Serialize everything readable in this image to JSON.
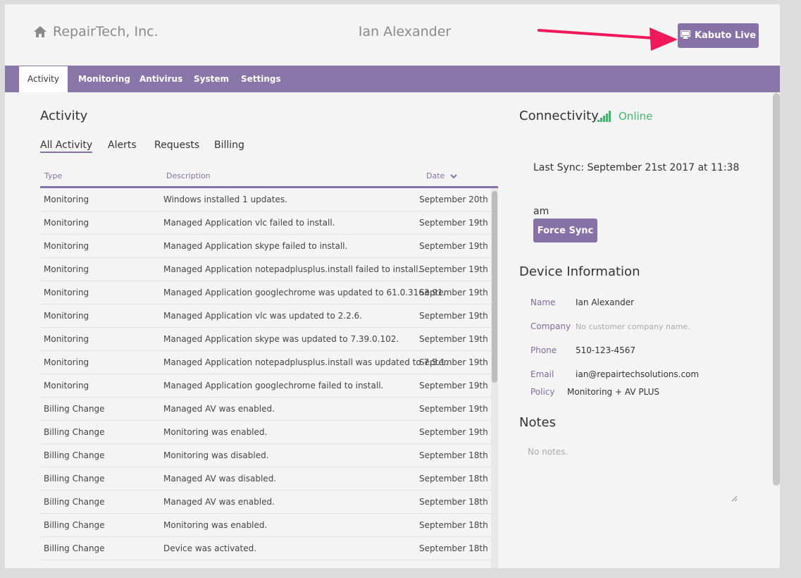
{
  "header": {
    "company": "RepairTech, Inc.",
    "user": "Ian Alexander",
    "kabuto_button": "Kabuto Live",
    "home_icon": "home-icon",
    "monitor_icon": "monitor-icon"
  },
  "tabs": [
    "Activity",
    "Monitoring",
    "Antivirus",
    "System",
    "Settings"
  ],
  "activity": {
    "title": "Activity",
    "subtabs": [
      "All Activity",
      "Alerts",
      "Requests",
      "Billing"
    ],
    "columns": {
      "type": "Type",
      "description": "Description",
      "date": "Date"
    },
    "rows": [
      {
        "type": "Monitoring",
        "description": "Windows installed 1 updates.",
        "date": "September 20th"
      },
      {
        "type": "Monitoring",
        "description": "Managed Application vlc failed to install.",
        "date": "September 19th"
      },
      {
        "type": "Monitoring",
        "description": "Managed Application skype failed to install.",
        "date": "September 19th"
      },
      {
        "type": "Monitoring",
        "description": "Managed Application notepadplusplus.install failed to install.",
        "date": "September 19th"
      },
      {
        "type": "Monitoring",
        "description": "Managed Application googlechrome was updated to 61.0.3163.91.",
        "date": "September 19th"
      },
      {
        "type": "Monitoring",
        "description": "Managed Application vlc was updated to 2.2.6.",
        "date": "September 19th"
      },
      {
        "type": "Monitoring",
        "description": "Managed Application skype was updated to 7.39.0.102.",
        "date": "September 19th"
      },
      {
        "type": "Monitoring",
        "description": "Managed Application notepadplusplus.install was updated to 7.5.1.",
        "date": "September 19th"
      },
      {
        "type": "Monitoring",
        "description": "Managed Application googlechrome failed to install.",
        "date": "September 19th"
      },
      {
        "type": "Billing Change",
        "description": "Managed AV was enabled.",
        "date": "September 19th"
      },
      {
        "type": "Billing Change",
        "description": "Monitoring was enabled.",
        "date": "September 19th"
      },
      {
        "type": "Billing Change",
        "description": "Monitoring was disabled.",
        "date": "September 18th"
      },
      {
        "type": "Billing Change",
        "description": "Managed AV was disabled.",
        "date": "September 18th"
      },
      {
        "type": "Billing Change",
        "description": "Managed AV was enabled.",
        "date": "September 18th"
      },
      {
        "type": "Billing Change",
        "description": "Monitoring was enabled.",
        "date": "September 18th"
      },
      {
        "type": "Billing Change",
        "description": "Device was activated.",
        "date": "September 18th"
      }
    ]
  },
  "connectivity": {
    "title": "Connectivity",
    "status": "Online",
    "status_color": "#3fb96b",
    "last_sync": "Last Sync: September 21st 2017 at 11:38 am",
    "force_sync": "Force Sync"
  },
  "device": {
    "title": "Device Information",
    "name_label": "Name",
    "name": "Ian Alexander",
    "company_label": "Company",
    "company": "No customer company name.",
    "phone_label": "Phone",
    "phone": "510-123-4567",
    "email_label": "Email",
    "email": "ian@repairtechsolutions.com",
    "policy_label": "Policy",
    "policy": "Monitoring + AV PLUS"
  },
  "notes": {
    "title": "Notes",
    "placeholder": "No notes."
  },
  "colors": {
    "accent": "#8672a6",
    "arrow": "#f0185a"
  }
}
